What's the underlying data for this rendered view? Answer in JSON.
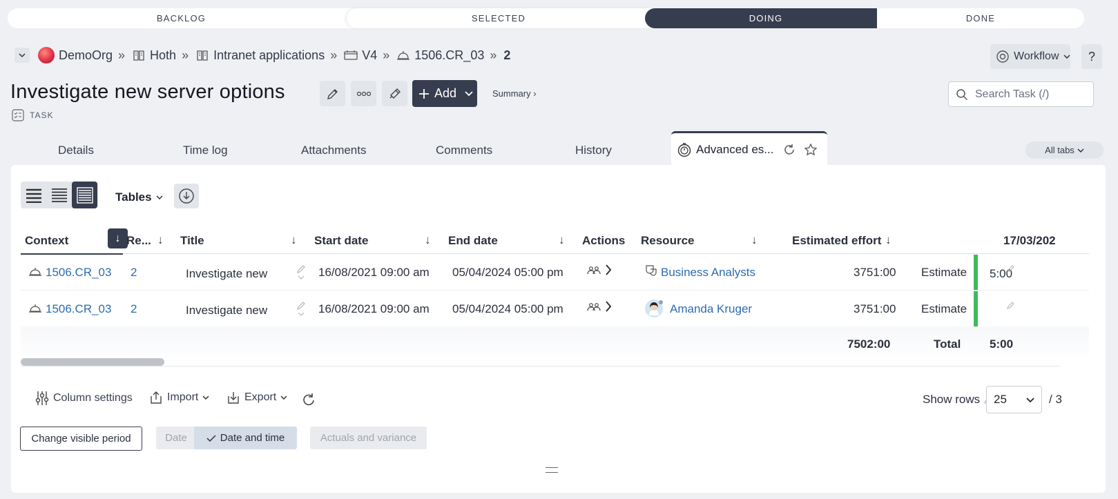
{
  "workflow": {
    "steps": [
      {
        "label": "BACKLOG",
        "state": "past"
      },
      {
        "label": "SELECTED",
        "state": "past"
      },
      {
        "label": "DOING",
        "state": "current"
      },
      {
        "label": "DONE",
        "state": "future"
      }
    ]
  },
  "breadcrumb": {
    "items": [
      {
        "label": "DemoOrg",
        "icon": "org-avatar-icon"
      },
      {
        "label": "Hoth",
        "icon": "book-icon"
      },
      {
        "label": "Intranet applications",
        "icon": "book-icon"
      },
      {
        "label": "V4",
        "icon": "calendar-icon"
      },
      {
        "label": "1506.CR_03",
        "icon": "bell-icon"
      },
      {
        "label": "2",
        "icon": ""
      }
    ],
    "separator": "»"
  },
  "header": {
    "workflow_button": "Workflow",
    "help_button": "?",
    "title": "Investigate new server options",
    "type_label": "TASK",
    "add_button": "Add",
    "summary_link": "Summary ›",
    "search_placeholder": "Search Task (/)"
  },
  "tabs": {
    "items": [
      "Details",
      "Time log",
      "Attachments",
      "Comments",
      "History"
    ],
    "active": "Advanced es...",
    "all_tabs": "All tabs"
  },
  "toolbar": {
    "tables_label": "Tables"
  },
  "grid": {
    "columns": [
      "Context",
      "Re...",
      "Title",
      "Start date",
      "End date",
      "Actions",
      "Resource",
      "Estimated effort",
      "17/03/202"
    ],
    "rows": [
      {
        "context": "1506.CR_03",
        "ref": "2",
        "title": "Investigate new",
        "start": "16/08/2021 09:00 am",
        "end": "05/04/2024 05:00 pm",
        "resource": "Business Analysts",
        "resource_icon": "team-mask-icon",
        "effort": "3751:00",
        "effort_type": "Estimate",
        "period_value": "5:00"
      },
      {
        "context": "1506.CR_03",
        "ref": "2",
        "title": "Investigate new",
        "start": "16/08/2021 09:00 am",
        "end": "05/04/2024 05:00 pm",
        "resource": "Amanda Kruger",
        "resource_icon": "user-avatar-icon",
        "effort": "3751:00",
        "effort_type": "Estimate",
        "period_value": ""
      }
    ],
    "totals": {
      "effort": "7502:00",
      "label": "Total",
      "period_value": "5:00"
    }
  },
  "footer": {
    "column_settings": "Column settings",
    "import": "Import",
    "export": "Export",
    "show_rows_label": "Show rows",
    "show_rows_value": "25",
    "show_rows_options": [
      "25"
    ],
    "rows_total": "/ 3",
    "change_period": "Change visible period",
    "date_toggle": "Date",
    "date_time_toggle": "Date and time",
    "actuals_variance": "Actuals and variance"
  },
  "colors": {
    "primary_dark": "#363d4e",
    "link": "#2b6cb0",
    "estimate_bar": "#3dbb5c"
  }
}
